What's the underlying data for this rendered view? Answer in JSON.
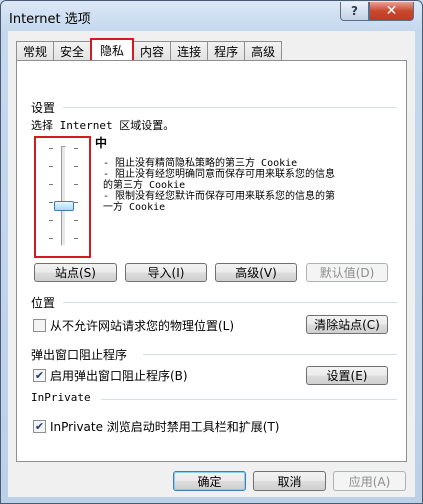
{
  "window": {
    "title": "Internet 选项",
    "help_glyph": "?",
    "close_glyph": "✕"
  },
  "tabs": [
    {
      "label": "常规"
    },
    {
      "label": "安全"
    },
    {
      "label": "隐私",
      "active": true
    },
    {
      "label": "内容"
    },
    {
      "label": "连接"
    },
    {
      "label": "程序"
    },
    {
      "label": "高级"
    }
  ],
  "settings": {
    "heading": "设置",
    "instruction": "选择 Internet 区域设置。",
    "level_name": "中",
    "slider_level": "中",
    "descriptions": [
      "- 阻止没有精简隐私策略的第三方 Cookie",
      "- 阻止没有经您明确同意而保存可用来联系您的信息",
      "的第三方 Cookie",
      "- 限制没有经您默许而保存可用来联系您的信息的第",
      "一方 Cookie"
    ],
    "buttons": {
      "sites": "站点(S)",
      "import": "导入(I)",
      "advanced": "高级(V)",
      "default": "默认值(D)"
    }
  },
  "location": {
    "heading": "位置",
    "checkbox_label": "从不允许网站请求您的物理位置(L)",
    "checked": false,
    "clear_sites_button": "清除站点(C)"
  },
  "popup": {
    "heading": "弹出窗口阻止程序",
    "checkbox_label": "启用弹出窗口阻止程序(B)",
    "checked": true,
    "settings_button": "设置(E)"
  },
  "inprivate": {
    "heading": "InPrivate",
    "checkbox_label": "InPrivate 浏览启动时禁用工具栏和扩展(T)",
    "checked": true
  },
  "footer": {
    "ok": "确定",
    "cancel": "取消",
    "apply": "应用(A)"
  },
  "check_glyph": "✔"
}
